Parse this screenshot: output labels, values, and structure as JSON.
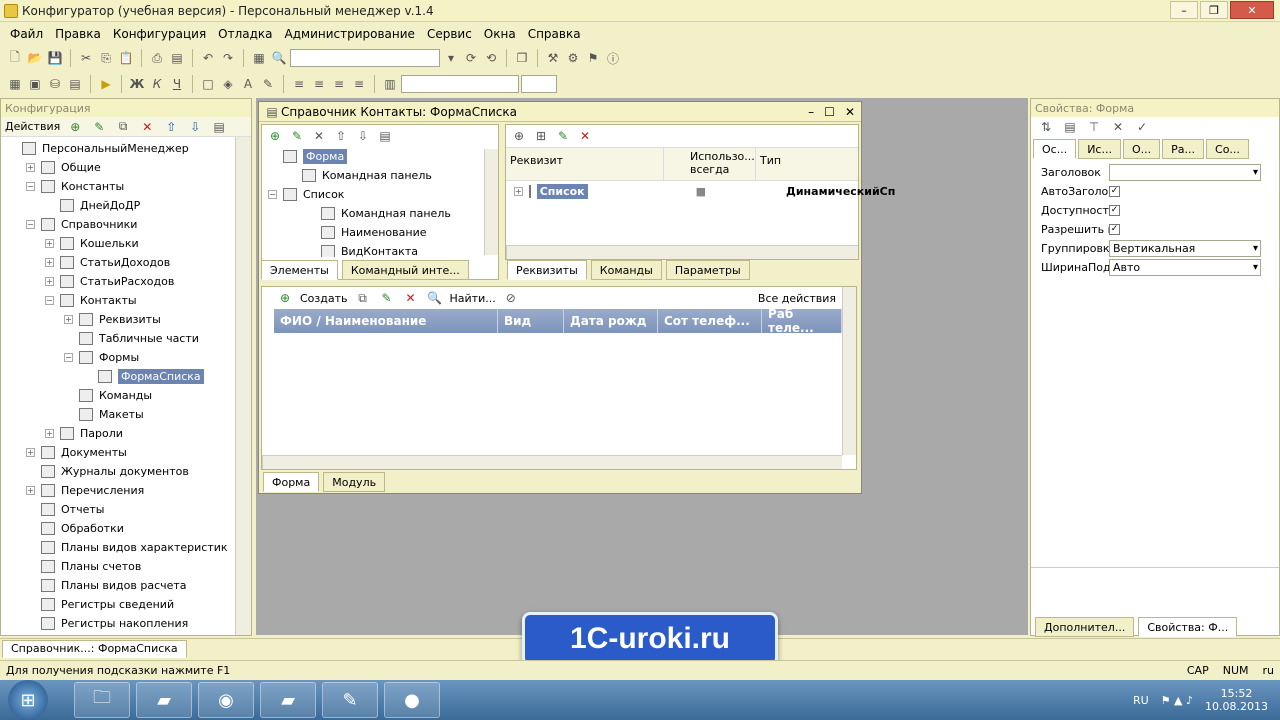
{
  "window": {
    "title": "Конфигуратор (учебная версия) - Персональный менеджер v.1.4"
  },
  "menu": [
    "Файл",
    "Правка",
    "Конфигурация",
    "Отладка",
    "Администрирование",
    "Сервис",
    "Окна",
    "Справка"
  ],
  "config": {
    "header": "Конфигурация",
    "actions": "Действия",
    "tree": [
      {
        "label": "ПерсональныйМенеджер",
        "level": 0,
        "exp": ""
      },
      {
        "label": "Общие",
        "level": 1,
        "exp": "+"
      },
      {
        "label": "Константы",
        "level": 1,
        "exp": "−"
      },
      {
        "label": "ДнейДоДР",
        "level": 2,
        "exp": ""
      },
      {
        "label": "Справочники",
        "level": 1,
        "exp": "−"
      },
      {
        "label": "Кошельки",
        "level": 2,
        "exp": "+"
      },
      {
        "label": "СтатьиДоходов",
        "level": 2,
        "exp": "+"
      },
      {
        "label": "СтатьиРасходов",
        "level": 2,
        "exp": "+"
      },
      {
        "label": "Контакты",
        "level": 2,
        "exp": "−"
      },
      {
        "label": "Реквизиты",
        "level": 3,
        "exp": "+"
      },
      {
        "label": "Табличные части",
        "level": 3,
        "exp": ""
      },
      {
        "label": "Формы",
        "level": 3,
        "exp": "−"
      },
      {
        "label": "ФормаСписка",
        "level": 4,
        "exp": "",
        "selected": true
      },
      {
        "label": "Команды",
        "level": 3,
        "exp": ""
      },
      {
        "label": "Макеты",
        "level": 3,
        "exp": ""
      },
      {
        "label": "Пароли",
        "level": 2,
        "exp": "+"
      },
      {
        "label": "Документы",
        "level": 1,
        "exp": "+"
      },
      {
        "label": "Журналы документов",
        "level": 1,
        "exp": ""
      },
      {
        "label": "Перечисления",
        "level": 1,
        "exp": "+"
      },
      {
        "label": "Отчеты",
        "level": 1,
        "exp": ""
      },
      {
        "label": "Обработки",
        "level": 1,
        "exp": ""
      },
      {
        "label": "Планы видов характеристик",
        "level": 1,
        "exp": ""
      },
      {
        "label": "Планы счетов",
        "level": 1,
        "exp": ""
      },
      {
        "label": "Планы видов расчета",
        "level": 1,
        "exp": ""
      },
      {
        "label": "Регистры сведений",
        "level": 1,
        "exp": ""
      },
      {
        "label": "Регистры накопления",
        "level": 1,
        "exp": ""
      }
    ]
  },
  "form": {
    "title": "Справочник Контакты: ФормаСписка",
    "elements": [
      {
        "label": "Форма",
        "level": 0,
        "exp": "",
        "selected": true
      },
      {
        "label": "Командная панель",
        "level": 1,
        "exp": ""
      },
      {
        "label": "Список",
        "level": 0,
        "exp": "−"
      },
      {
        "label": "Командная панель",
        "level": 2,
        "exp": ""
      },
      {
        "label": "Наименование",
        "level": 2,
        "exp": ""
      },
      {
        "label": "ВидКонтакта",
        "level": 2,
        "exp": ""
      }
    ],
    "left_tabs": [
      "Элементы",
      "Командный инте..."
    ],
    "attr_headers": [
      "Реквизит",
      "Использо... всегда",
      "Тип"
    ],
    "attr_row": {
      "name": "Список",
      "type": "ДинамическийСп"
    },
    "right_tabs": [
      "Реквизиты",
      "Команды",
      "Параметры"
    ],
    "preview": {
      "create": "Создать",
      "find": "Найти...",
      "all_actions": "Все действия",
      "columns": [
        "ФИО / Наименование",
        "Вид",
        "Дата рожд",
        "Сот телеф...",
        "Раб теле..."
      ]
    },
    "bottom_tabs": [
      "Форма",
      "Модуль"
    ]
  },
  "props": {
    "header": "Свойства: Форма",
    "tabs": [
      "Ос...",
      "Ис...",
      "О...",
      "Ра...",
      "Со..."
    ],
    "rows": [
      {
        "label": "Заголовок",
        "kind": "text",
        "value": ""
      },
      {
        "label": "АвтоЗаголовок",
        "kind": "check",
        "value": "✓"
      },
      {
        "label": "Доступность",
        "kind": "check",
        "value": "✓"
      },
      {
        "label": "Разрешить изм",
        "kind": "check",
        "value": "✓"
      },
      {
        "label": "Группировка",
        "kind": "combo",
        "value": "Вертикальная"
      },
      {
        "label": "ШиринаПодчин",
        "kind": "combo",
        "value": "Авто"
      }
    ],
    "bottom_tabs": [
      "Дополнител...",
      "Свойства: Ф..."
    ]
  },
  "windowbar": "Справочник...: ФормаСписка",
  "watermark": "1C-uroki.ru",
  "status": {
    "hint": "Для получения подсказки нажмите F1",
    "cap": "CAP",
    "num": "NUM",
    "lang": "ru"
  },
  "taskbar": {
    "lang": "RU",
    "time": "15:52",
    "date": "10.08.2013"
  }
}
